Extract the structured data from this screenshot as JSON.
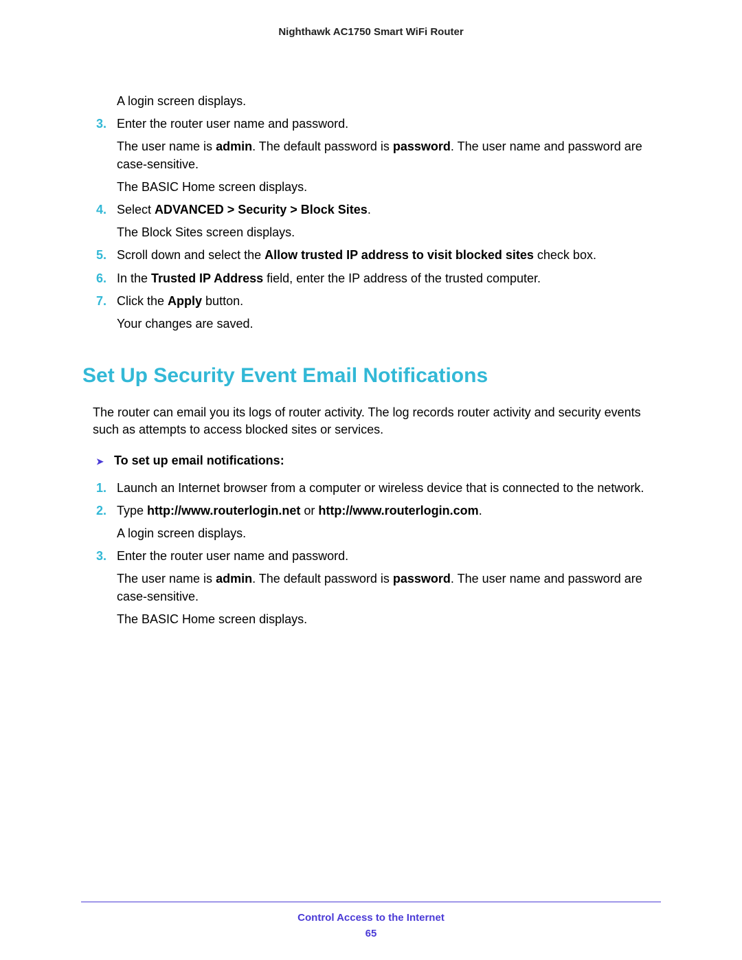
{
  "header": {
    "title": "Nighthawk AC1750 Smart WiFi Router"
  },
  "body": {
    "p1": "A login screen displays.",
    "s3": {
      "num": "3.",
      "text": "Enter the router user name and password."
    },
    "p2a": "The user name is ",
    "p2b": "admin",
    "p2c": ". The default password is ",
    "p2d": "password",
    "p2e": ". The user name and password are case-sensitive.",
    "p3": "The BASIC Home screen displays.",
    "s4": {
      "num": "4.",
      "a": "Select ",
      "b": "ADVANCED > Security > Block Sites",
      "c": "."
    },
    "p4": "The Block Sites screen displays.",
    "s5": {
      "num": "5.",
      "a": "Scroll down and select the ",
      "b": "Allow trusted IP address to visit blocked sites",
      "c": " check box."
    },
    "s6": {
      "num": "6.",
      "a": "In the ",
      "b": "Trusted IP Address",
      "c": " field, enter the IP address of the trusted computer."
    },
    "s7": {
      "num": "7.",
      "a": "Click the ",
      "b": "Apply",
      "c": " button."
    },
    "p5": "Your changes are saved.",
    "heading": "Set Up Security Event Email Notifications",
    "intro": "The router can email you its logs of router activity. The log records router activity and security events such as attempts to access blocked sites or services.",
    "task": "To set up email notifications:",
    "t1": {
      "num": "1.",
      "text": "Launch an Internet browser from a computer or wireless device that is connected to the network."
    },
    "t2": {
      "num": "2.",
      "a": "Type ",
      "b": "http://www.routerlogin.net",
      "c": " or ",
      "d": "http://www.routerlogin.com",
      "e": "."
    },
    "tp1": "A login screen displays.",
    "t3": {
      "num": "3.",
      "text": "Enter the router user name and password."
    },
    "tp2a": "The user name is ",
    "tp2b": "admin",
    "tp2c": ". The default password is ",
    "tp2d": "password",
    "tp2e": ". The user name and password are case-sensitive.",
    "tp3": "The BASIC Home screen displays."
  },
  "footer": {
    "section": "Control Access to the Internet",
    "page": "65"
  }
}
